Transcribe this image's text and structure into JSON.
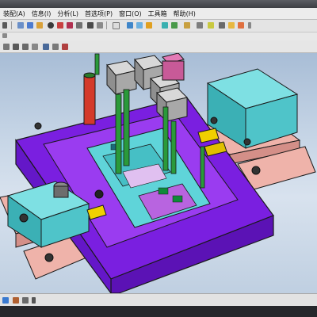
{
  "menubar": {
    "items": [
      {
        "label": "装配(A)"
      },
      {
        "label": "信息(I)"
      },
      {
        "label": "分析(L)"
      },
      {
        "label": "首选项(P)"
      },
      {
        "label": "窗口(O)"
      },
      {
        "label": "工具箱"
      },
      {
        "label": "帮助(H)"
      }
    ]
  },
  "icons": {
    "fourth_bar_dropdown": "chevron-down-icon"
  },
  "colors": {
    "menubar_bg": "#ececec",
    "toolbar_bg": "#e4e4e4",
    "viewport_gradient_top": "#a8bdd6",
    "viewport_gradient_bottom": "#bfcfe1",
    "mold_base_purple": "#7a1fe0",
    "cavity_plate_purple": "#9a3cf0",
    "insert_cyan": "#5fd4d9",
    "plate_pink": "#efb3aa",
    "pin_green": "#2a9a3a",
    "pin_red": "#d43a2a",
    "yellow_block": "#f0d000"
  }
}
